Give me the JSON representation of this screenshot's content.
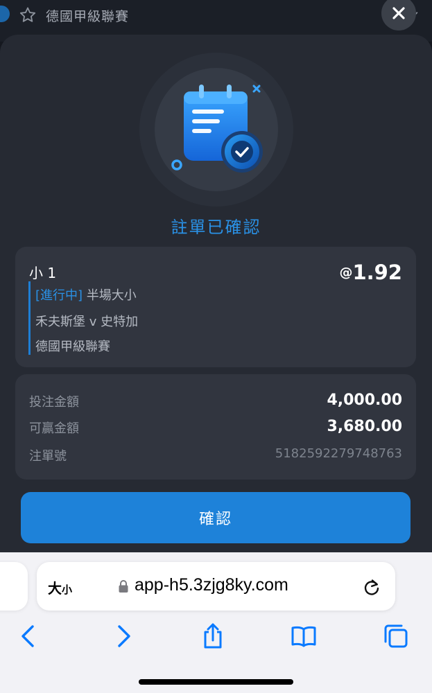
{
  "background_header": {
    "league_title": "德國甲級聯賽",
    "star_icon": "star-outline-icon",
    "chevron_icon": "chevron-down-icon"
  },
  "modal": {
    "close_icon": "close-icon",
    "illustration_icon": "calendar-check-icon",
    "title": "註單已確認",
    "bet": {
      "selection": "小 1",
      "odds_prefix": "@",
      "odds": "1.92",
      "status_tag": "[進行中]",
      "market": "半場大小",
      "match": "禾夫斯堡 v 史特加",
      "league": "德國甲級聯賽"
    },
    "summary": {
      "stake_label": "投注金額",
      "stake_value": "4,000.00",
      "win_label": "可贏金額",
      "win_value": "3,680.00",
      "ticket_label": "注單號",
      "ticket_value": "5182592279748763"
    },
    "confirm_button": "確認"
  },
  "browser": {
    "reader_big": "大",
    "reader_small": "小",
    "url": "app-h5.3zjg8ky.com",
    "lock_icon": "lock-icon",
    "reload_icon": "reload-icon",
    "toolbar": [
      {
        "icon": "back-icon"
      },
      {
        "icon": "forward-icon"
      },
      {
        "icon": "share-icon"
      },
      {
        "icon": "bookmarks-icon"
      },
      {
        "icon": "tabs-icon"
      }
    ]
  },
  "colors": {
    "accent": "#1e82d9",
    "modal_bg": "#262a33",
    "card_bg": "#31353f",
    "ios_blue": "#0a7aff"
  }
}
